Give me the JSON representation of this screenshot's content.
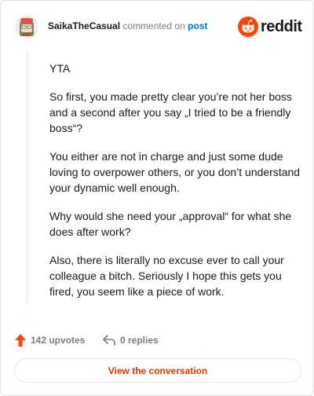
{
  "header": {
    "username": "SaikaTheCasual",
    "action_text": "commented on",
    "post_link": "post",
    "logo_text": "reddit"
  },
  "comment": {
    "paragraphs": [
      "YTA",
      "So first, you made pretty clear you’re not her boss and a second after you say „I tried to be a friendly boss“?",
      "You either are not in charge and just some dude loving to overpower others, or you don’t understand your dynamic well enough.",
      "Why would she need your „approval“ for what she does after work?",
      "Also, there is literally no excuse ever to call your colleague a bitch. Seriously I hope this gets you fired, you seem like a piece of work."
    ]
  },
  "actions": {
    "upvotes": "142 upvotes",
    "replies": "0 replies"
  },
  "cta": {
    "label": "View the conversation"
  },
  "colors": {
    "accent": "#ff4500",
    "link": "#0079d3",
    "cta_text": "#d93a00",
    "muted": "#7c7c7c"
  }
}
